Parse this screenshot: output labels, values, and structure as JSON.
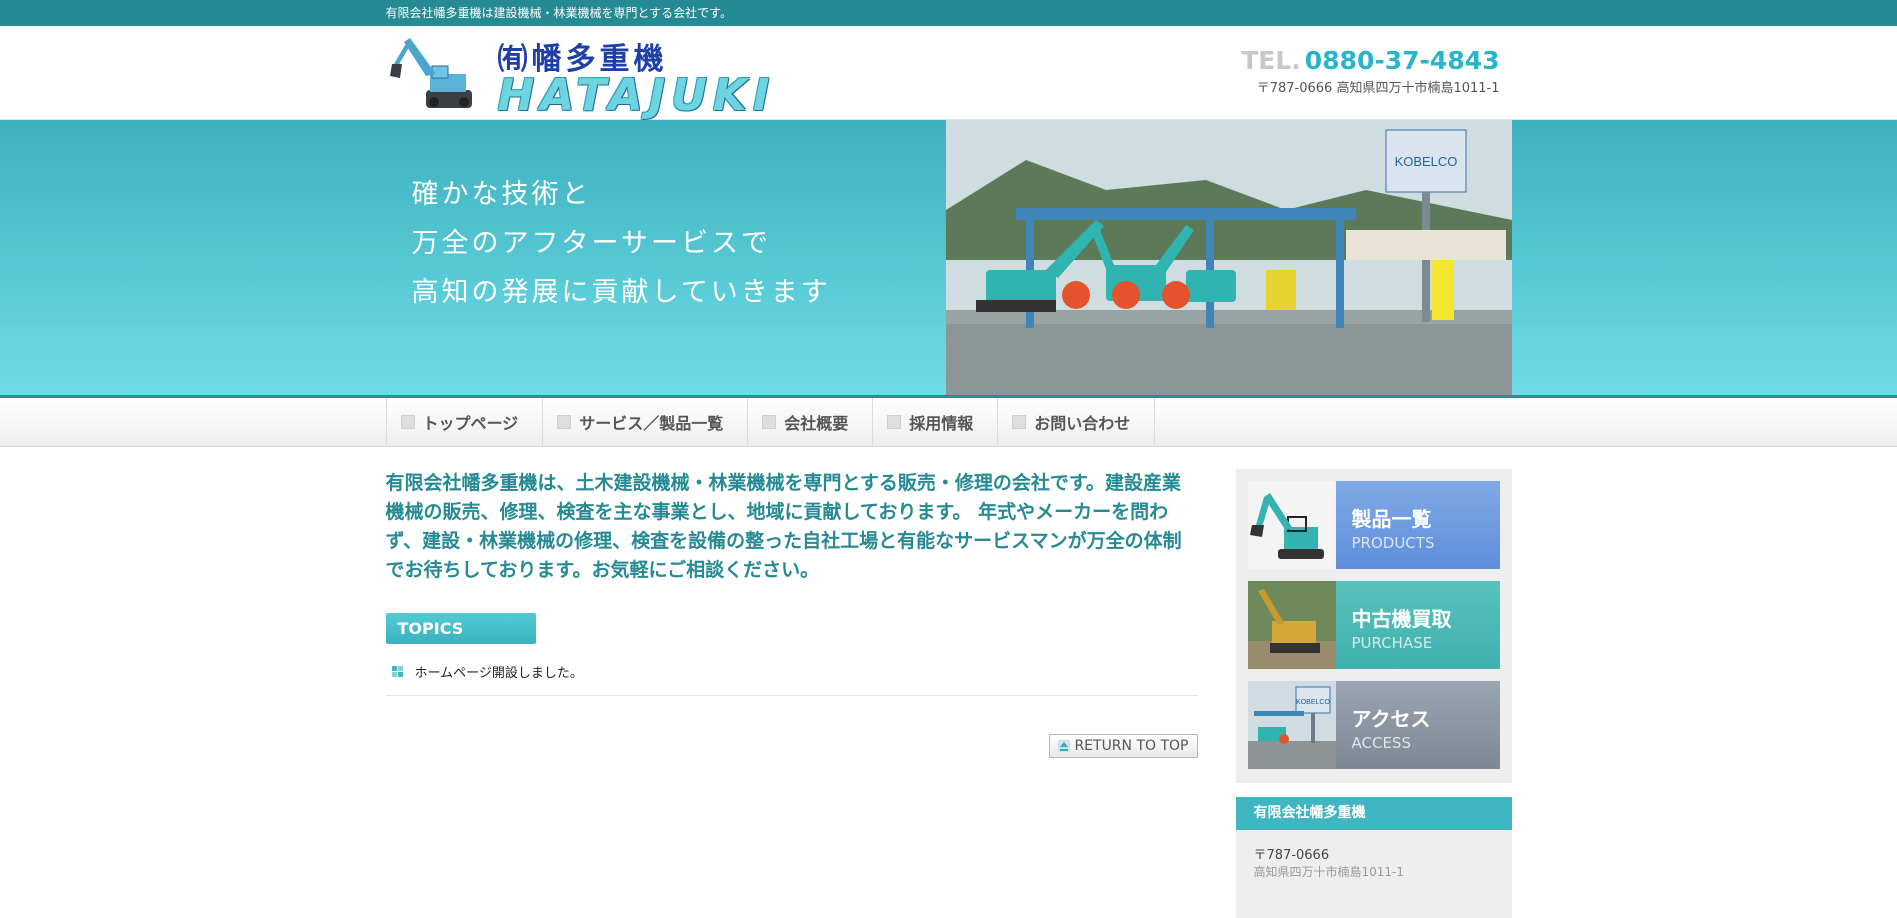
{
  "topbar": {
    "text": "有限会社幡多重機は建設機械・林業機械を専門とする会社です。"
  },
  "header": {
    "logo_top": "㈲幡多重機",
    "logo_bottom": "HATAJUKI",
    "tel_prefix": "TEL.",
    "tel_number": "0880-37-4843",
    "address": "〒787-0666 高知県四万十市楠島1011-1"
  },
  "hero": {
    "lines": [
      "確かな技術と",
      "万全のアフターサービスで",
      "高知の発展に貢献していきます"
    ],
    "sign_text": "KOBELCO"
  },
  "nav": {
    "items": [
      {
        "label": "トップページ"
      },
      {
        "label": "サービス／製品一覧"
      },
      {
        "label": "会社概要"
      },
      {
        "label": "採用情報"
      },
      {
        "label": "お問い合わせ"
      }
    ]
  },
  "main": {
    "intro": "有限会社幡多重機は、土木建設機械・林業機械を専門とする販売・修理の会社です。建設産業機械の販売、修理、検査を主な事業とし、地域に貢献しております。 年式やメーカーを問わず、建設・林業機械の修理、検査を設備の整った自社工場と有能なサービスマンが万全の体制でお待ちしております。お気軽にご相談ください。",
    "topics_title": "TOPICS",
    "topics": [
      {
        "text": "ホームページ開設しました。"
      }
    ],
    "return_top": "RETURN TO TOP"
  },
  "sidebar": {
    "banners": [
      {
        "jp": "製品一覧",
        "en": "PRODUCTS",
        "image_sign": ""
      },
      {
        "jp": "中古機買取",
        "en": "PURCHASE",
        "image_sign": ""
      },
      {
        "jp": "アクセス",
        "en": "ACCESS",
        "image_sign": "KOBELCO"
      }
    ],
    "company_title": "有限会社幡多重機",
    "company_zip": "〒787-0666",
    "company_addr_partial": "高知県四万十市楠島1011-1"
  },
  "colors": {
    "teal": "#258a94",
    "accent": "#27b6c9",
    "products": "#6d9ae0",
    "purchase": "#4db9b6",
    "access": "#8a95a1"
  }
}
